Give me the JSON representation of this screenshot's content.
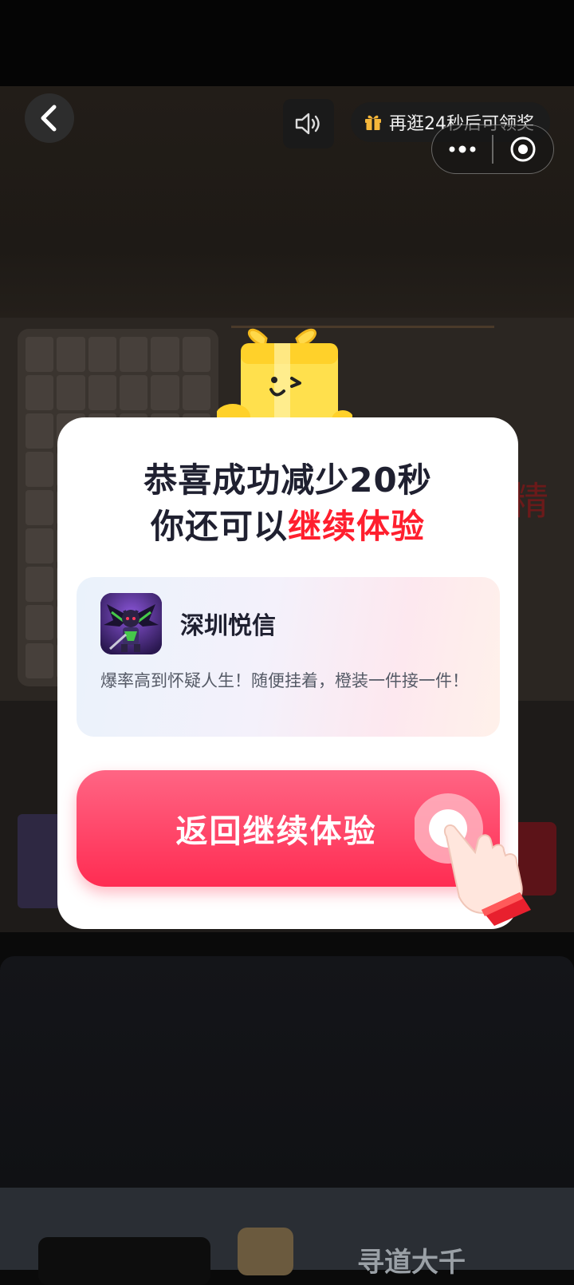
{
  "header": {
    "reward_text": "再逛24秒后可领奖",
    "icons": {
      "back": "chevron-left-icon",
      "sound": "speaker-icon",
      "reward": "gift-icon",
      "more": "more-dots-icon",
      "close": "target-circle-icon"
    }
  },
  "background": {
    "partial_text": "精",
    "bottom_title": "寻道大千"
  },
  "modal": {
    "title_line1": "恭喜成功减少20秒",
    "title_line2_prefix": "你还可以",
    "title_line2_highlight": "继续体验",
    "app": {
      "name": "深圳悦信",
      "description": "爆率高到怀疑人生！随便挂着，橙装一件接一件！"
    },
    "cta_label": "返回继续体验"
  },
  "colors": {
    "accent_red": "#ff1f2e",
    "cta_top": "#ff6584",
    "cta_bottom": "#ff2c52",
    "title_dark": "#1f2030"
  }
}
